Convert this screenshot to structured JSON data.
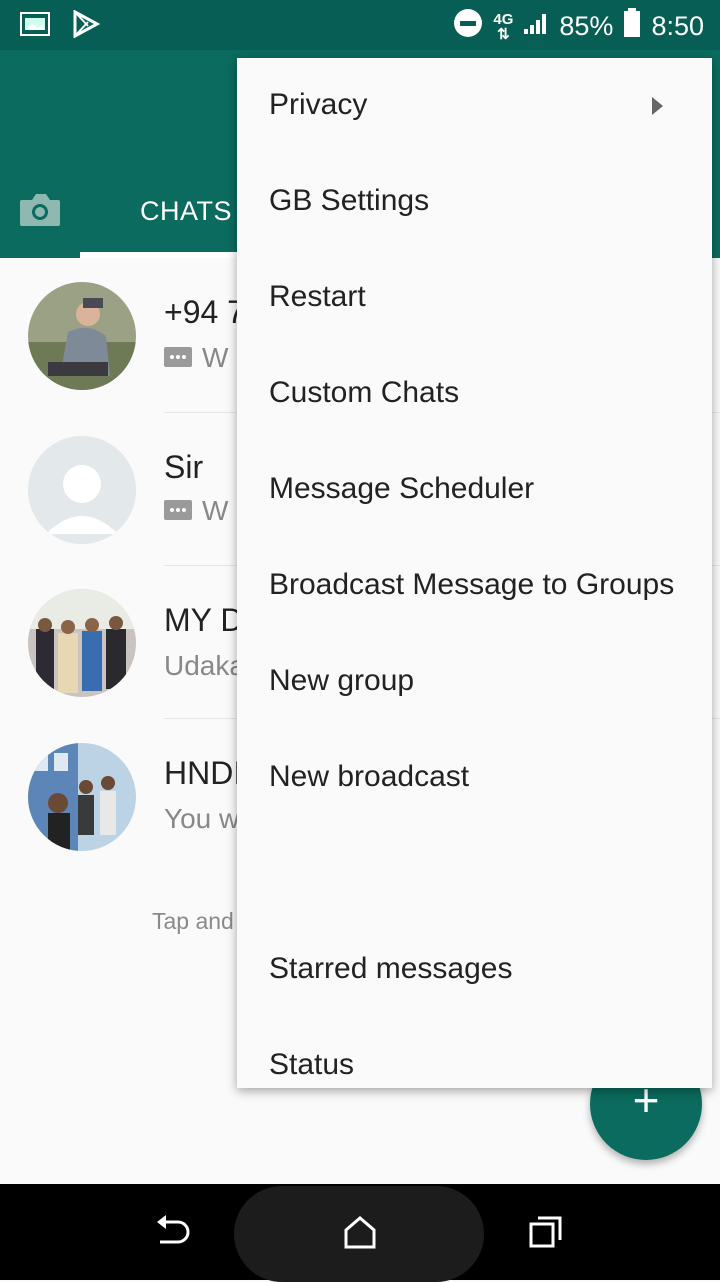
{
  "status_bar": {
    "battery_percent": "85%",
    "time": "8:50",
    "network": "4G",
    "icons": [
      "gallery-icon",
      "play-store-icon",
      "do-not-disturb-icon",
      "network-4g-icon",
      "signal-icon",
      "battery-icon"
    ]
  },
  "tabs": {
    "camera_icon": "camera-icon",
    "chats_label": "CHATS"
  },
  "chats": [
    {
      "name": "+94 7",
      "preview": "W",
      "has_msg_icon": true
    },
    {
      "name": "Sir",
      "preview": "W",
      "has_msg_icon": true
    },
    {
      "name": "MY D",
      "preview": "Udaka",
      "has_msg_icon": false
    },
    {
      "name": "HNDI",
      "preview": "You w",
      "has_msg_icon": false
    }
  ],
  "hint_text": "Tap and",
  "fab": {
    "label": "+"
  },
  "menu": {
    "items": [
      "Privacy",
      "GB Settings",
      "Restart",
      "Custom Chats",
      "Message Scheduler",
      "Broadcast Message to Groups",
      "New group",
      "New broadcast",
      "Starred messages",
      "Status"
    ]
  },
  "colors": {
    "primary": "#075e54",
    "accent": "#0b6b5e",
    "menu_bg": "#fafafa"
  }
}
